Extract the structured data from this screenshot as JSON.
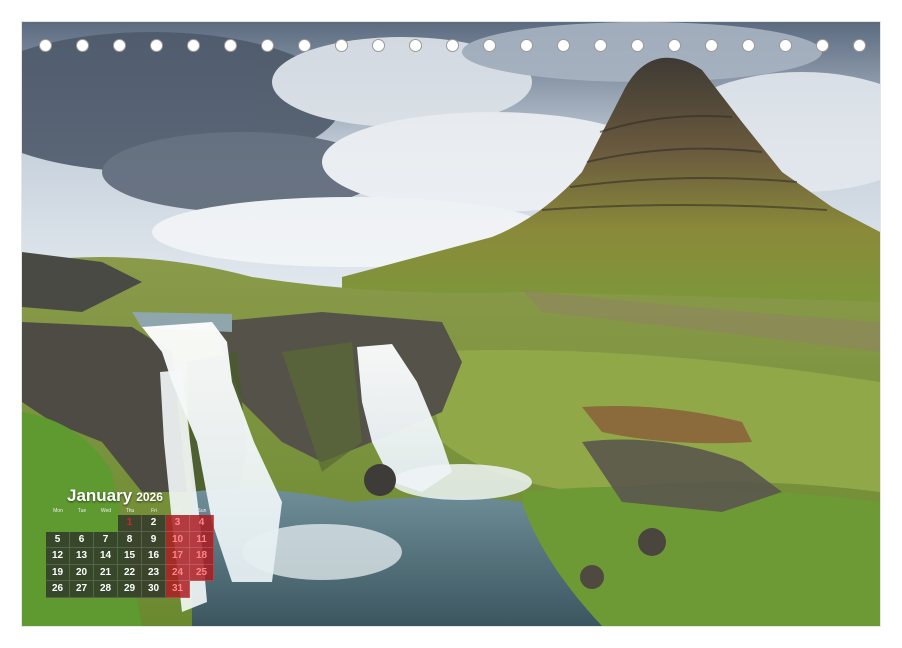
{
  "calendar": {
    "month": "January",
    "year": "2026",
    "weekdays": [
      "Mon",
      "Tue",
      "Wed",
      "Thu",
      "Fri",
      "Sat",
      "Sun"
    ],
    "weeks": [
      [
        "",
        "",
        "",
        "1",
        "2",
        "3",
        "4"
      ],
      [
        "5",
        "6",
        "7",
        "8",
        "9",
        "10",
        "11"
      ],
      [
        "12",
        "13",
        "14",
        "15",
        "16",
        "17",
        "18"
      ],
      [
        "19",
        "20",
        "21",
        "22",
        "23",
        "24",
        "25"
      ],
      [
        "26",
        "27",
        "28",
        "29",
        "30",
        "31",
        ""
      ]
    ],
    "holidays": [
      "1"
    ]
  },
  "colors": {
    "weekend_cell": "#aa1c22",
    "holiday_text": "#d1262f",
    "weekday_cell": "#282828",
    "binding_hole_border": "#9a9a9a"
  },
  "binding": {
    "hole_count": 23
  }
}
